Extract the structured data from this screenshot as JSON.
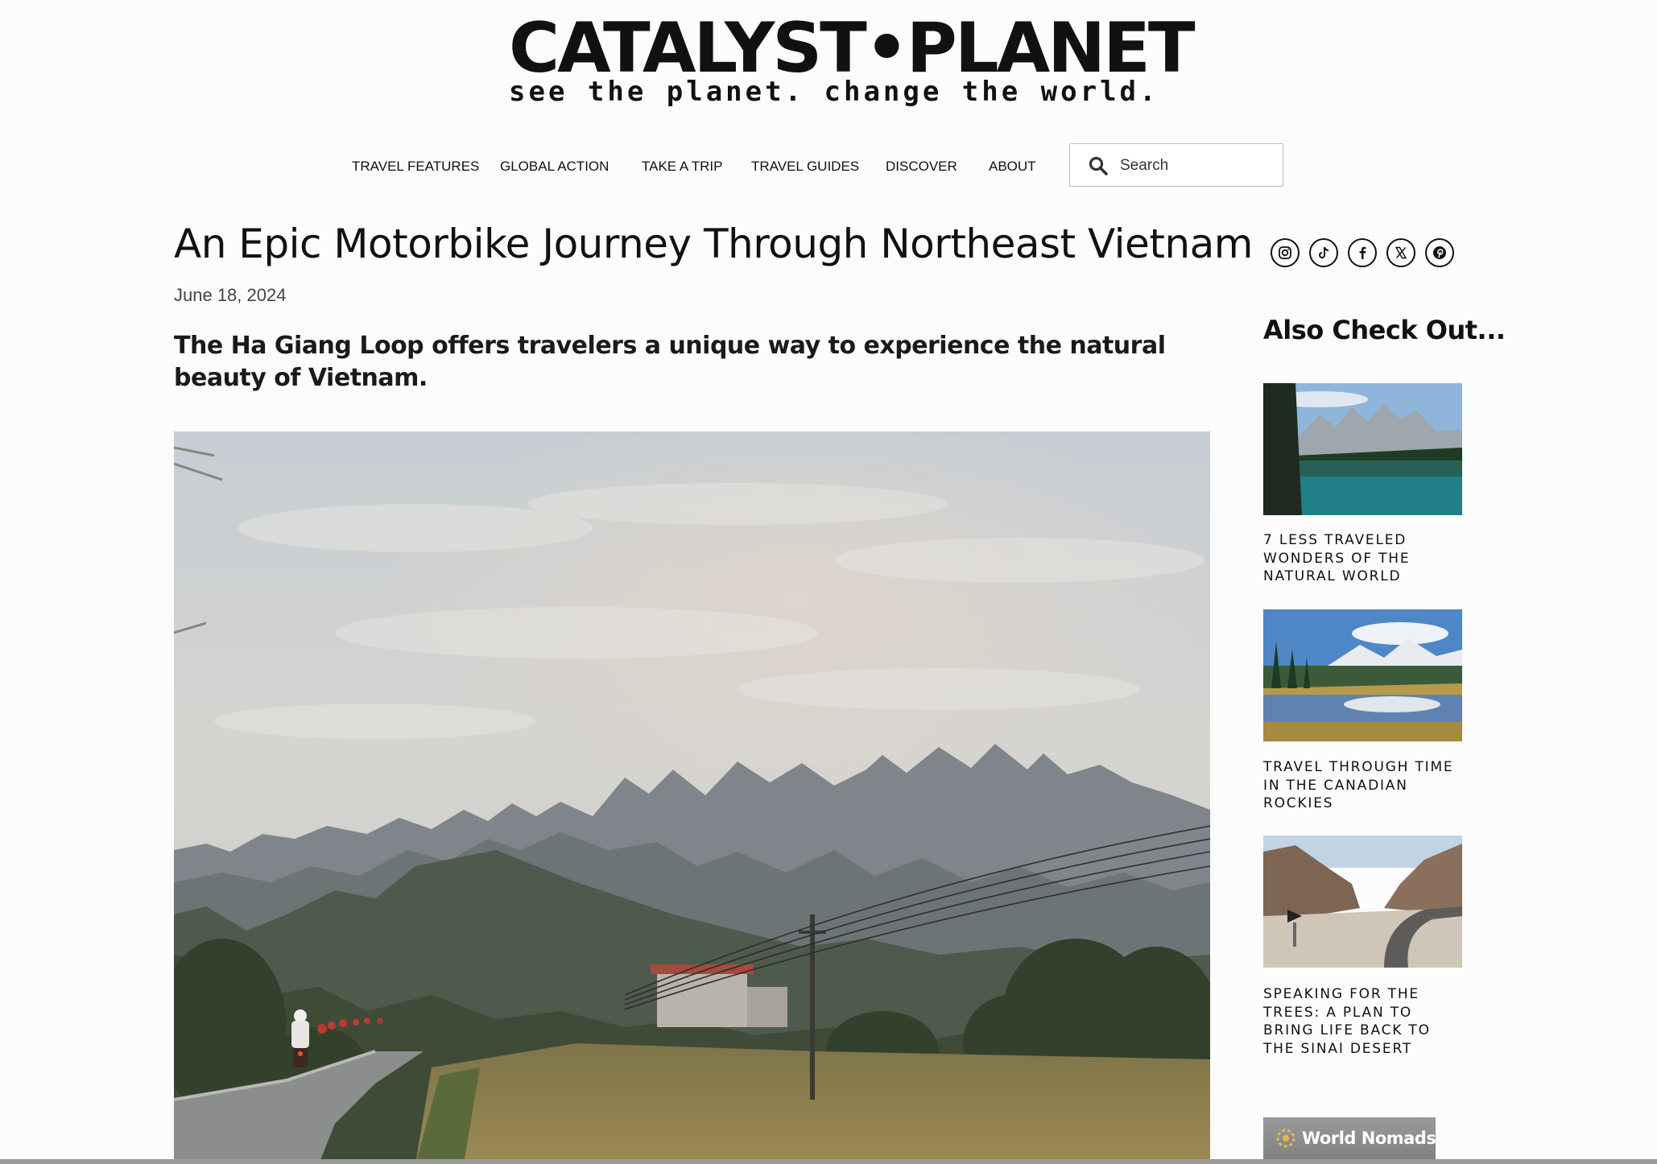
{
  "site": {
    "logo_main": "CATALYST•PLANET",
    "logo_tagline": "see the planet. change the world."
  },
  "nav": {
    "items": [
      {
        "label": "TRAVEL FEATURES"
      },
      {
        "label": "GLOBAL ACTION"
      },
      {
        "label": "TAKE A TRIP"
      },
      {
        "label": "TRAVEL GUIDES"
      },
      {
        "label": "DISCOVER"
      },
      {
        "label": "ABOUT"
      }
    ],
    "search_placeholder": "Search"
  },
  "article": {
    "title": "An Epic Motorbike Journey Through Northeast Vietnam",
    "date": "June 18, 2024",
    "subtitle": "The Ha Giang Loop offers travelers a unique way to experience the natural beauty of Vietnam."
  },
  "social": [
    "instagram-icon",
    "tiktok-icon",
    "facebook-icon",
    "x-icon",
    "pinterest-icon"
  ],
  "sidebar": {
    "heading": "Also Check Out...",
    "related": [
      {
        "title": "7 LESS TRAVELED WONDERS OF THE NATURAL WORLD"
      },
      {
        "title": "TRAVEL THROUGH TIME IN THE CANADIAN ROCKIES"
      },
      {
        "title": "SPEAKING FOR THE TREES: A PLAN TO BRING LIFE BACK TO THE SINAI DESERT"
      }
    ],
    "ad_text": "World Nomads"
  }
}
